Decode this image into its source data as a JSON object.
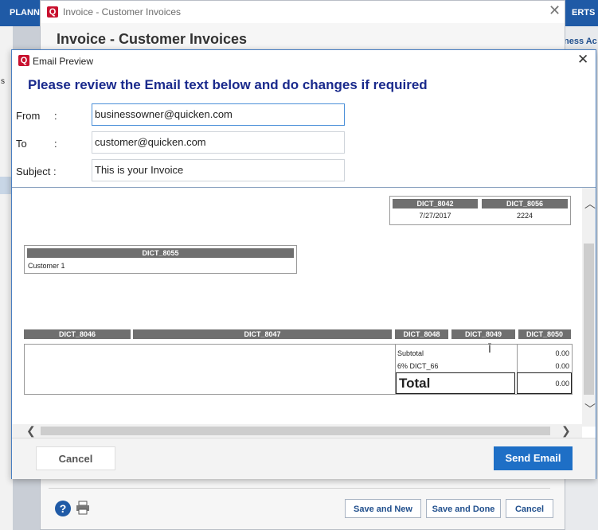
{
  "app": {
    "top_left_tab": "PLANN",
    "top_right_tab": "ERTS",
    "right_panel_label": "ness Ac",
    "left_panel_label": "s"
  },
  "invoice_window": {
    "title": "Invoice - Customer Invoices",
    "heading": "Invoice - Customer Invoices",
    "help_label": "?",
    "save_and_new": "Save and New",
    "save_and_done": "Save and Done",
    "cancel": "Cancel"
  },
  "email_dialog": {
    "title": "Email Preview",
    "heading": "Please review the Email text below and do changes if required",
    "from_label": "From",
    "to_label": "To",
    "subject_label": "Subject :",
    "colon": ":",
    "from_value": "businessowner@quicken.com",
    "to_value": "customer@quicken.com",
    "subject_value": "This is your Invoice",
    "cancel_label": "Cancel",
    "send_label": "Send Email"
  },
  "preview": {
    "date_header": "DICT_8042",
    "number_header": "DICT_8056",
    "date_value": "7/27/2017",
    "number_value": "2224",
    "customer_header": "DICT_8055",
    "customer_value": "Customer 1",
    "columns": [
      "DICT_8046",
      "DICT_8047",
      "DICT_8048",
      "DICT_8049",
      "DICT_8050"
    ],
    "subtotal_label": "Subtotal",
    "subtotal_value": "0.00",
    "tax_label": "6% DICT_66",
    "tax_value": "0.00",
    "total_label": "Total",
    "total_value": "0.00"
  },
  "icons": {
    "app_logo": "quicken-logo-icon",
    "close": "close-icon",
    "help": "help-icon",
    "print": "printer-icon",
    "scroll_up": "chevron-up-icon",
    "scroll_down": "chevron-down-icon",
    "scroll_left": "chevron-left-icon",
    "scroll_right": "chevron-right-icon",
    "text_cursor": "text-cursor-icon"
  },
  "colors": {
    "brand_blue": "#1f5aa6",
    "heading_navy": "#1a2a8c",
    "send_button": "#1e6fc6",
    "table_header": "#6f6f6f",
    "quicken_red": "#c8102e"
  }
}
